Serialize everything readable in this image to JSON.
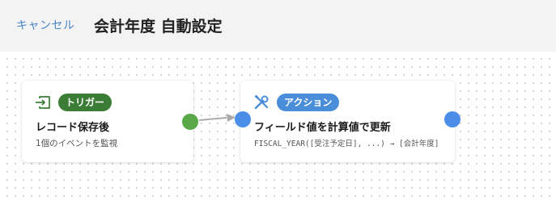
{
  "header": {
    "cancel_label": "キャンセル",
    "title": "会計年度 自動設定"
  },
  "trigger": {
    "icon": "enter-icon",
    "badge": "トリガー",
    "title": "レコード保存後",
    "subtitle": "1個のイベントを監視"
  },
  "action": {
    "icon": "tools-icon",
    "badge": "アクション",
    "title": "フィールド値を計算値で更新",
    "subtitle": "FISCAL_YEAR([受注予定日], ...) → [会計年度]"
  },
  "colors": {
    "accent_link": "#4a86c8",
    "trigger_badge": "#3b7d36",
    "action_badge": "#4a8dd9",
    "trigger_port": "#58a84a",
    "action_port": "#4b8ee8",
    "connector": "#aaaaaa"
  }
}
